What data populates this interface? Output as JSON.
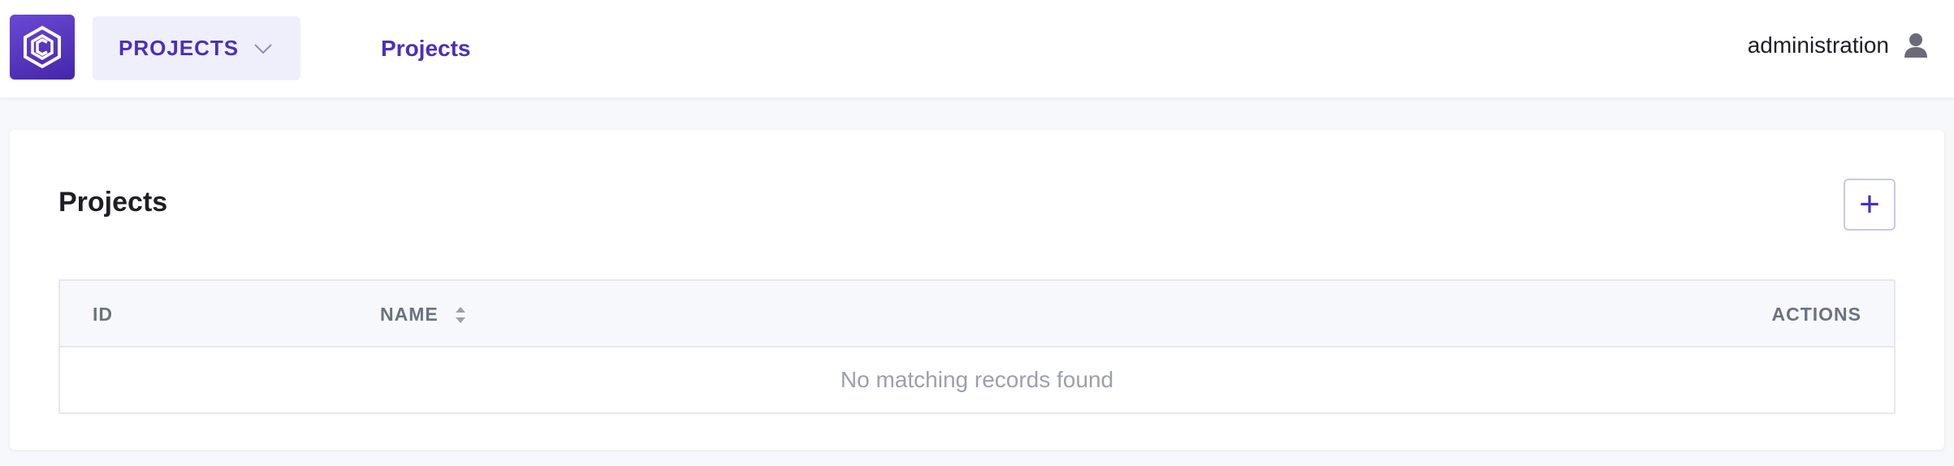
{
  "header": {
    "logo_icon": "app-logo-icon",
    "module_switcher": {
      "label": "PROJECTS",
      "icon": "chevron-down-icon"
    },
    "nav_link": "Projects",
    "user": {
      "name": "administration",
      "icon": "user-icon"
    }
  },
  "main": {
    "title": "Projects",
    "add_button": {
      "label": "+",
      "icon": "plus-icon"
    },
    "table": {
      "columns": [
        "ID",
        "NAME",
        "ACTIONS"
      ],
      "sort_icon": "sort-icon",
      "empty_message": "No matching records found"
    }
  },
  "colors": {
    "accent": "#4b2fb8",
    "logo_gradient_start": "#6a48d6",
    "logo_gradient_end": "#4526a8",
    "switcher_bg": "#efeffc",
    "page_bg": "#f7f8fc",
    "muted_text": "#9ca0ab",
    "header_text": "#6b7280"
  }
}
